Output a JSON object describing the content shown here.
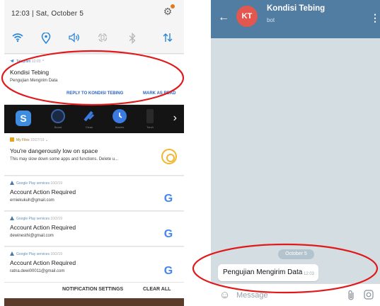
{
  "left_phone": {
    "status_bar": {
      "time": "12:03",
      "date": "Sat, October 5"
    },
    "quick_settings": [
      "wifi-icon",
      "location-icon",
      "sound-icon",
      "rotate-icon",
      "bluetooth-icon",
      "data-icon"
    ],
    "telegram_notification": {
      "app": "Telegram",
      "time": "12:03",
      "title": "Kondisi Tebing",
      "text": "Pengujian Mengirim Data",
      "action_reply": "REPLY TO KONDISI TEBING",
      "action_mark_read": "MARK AS READ"
    },
    "app_tray": {
      "apps": [
        "Boost",
        "Clean",
        "Alarms",
        "Torch"
      ]
    },
    "myfiles_notification": {
      "app": "My Files",
      "time": "10/27/19",
      "title": "You're dangerously low on space",
      "text": "This may slow down some apps and functions. Delete u..."
    },
    "google_notifications": [
      {
        "app": "Google Play services",
        "time": "10/2/19",
        "title": "Account Action Required",
        "email": "erniekukuh@gmail.com"
      },
      {
        "app": "Google Play services",
        "time": "10/2/19",
        "title": "Account Action Required",
        "email": "dewinesthi@gmail.com"
      },
      {
        "app": "Google Play services",
        "time": "10/2/19",
        "title": "Account Action Required",
        "email": "ratna.dewi00011@gmail.com"
      }
    ],
    "footer": {
      "settings_label": "NOTIFICATION SETTINGS",
      "clear_label": "CLEAR ALL"
    }
  },
  "right_phone": {
    "header": {
      "avatar_initials": "KT",
      "chat_name": "Kondisi Tebing",
      "subtitle": "bot"
    },
    "date_separator": "October 5",
    "message": {
      "text": "Pengujian Mengirim Data",
      "time": "12:03"
    },
    "input": {
      "placeholder": "Message"
    }
  },
  "colors": {
    "telegram_header": "#527da3",
    "avatar": "#e2574f",
    "chat_background": "#d3dde2",
    "annotation": "#e0191b",
    "accent_blue": "#2b63c4"
  }
}
